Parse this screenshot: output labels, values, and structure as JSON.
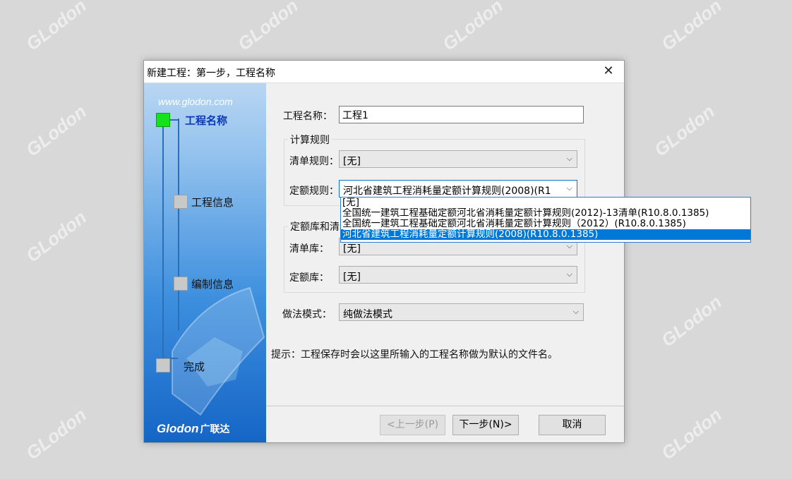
{
  "watermark": {
    "brand": "GLodon",
    "cn": "广联达"
  },
  "dialog": {
    "title": "新建工程：第一步，工程名称",
    "close_glyph": "✕"
  },
  "sidebar": {
    "site": "www.glodon.com",
    "steps": [
      {
        "label": "工程名称",
        "active": true
      },
      {
        "label": "工程信息",
        "active": false
      },
      {
        "label": "编制信息",
        "active": false
      },
      {
        "label": "完成",
        "active": false
      }
    ],
    "brand": "Glodon",
    "brand_cn": "广联达"
  },
  "form": {
    "project_name_label": "工程名称：",
    "project_name_value": "工程1",
    "calc_rules_group": "计算规则",
    "list_rule_label": "清单规则：",
    "list_rule_value": "[无]",
    "quota_rule_label": "定额规则：",
    "quota_rule_value": "河北省建筑工程消耗量定额计算规则(2008)(R1",
    "library_group": "定额库和清单库",
    "list_lib_label": "清单库：",
    "list_lib_value": "[无]",
    "quota_lib_label": "定额库：",
    "quota_lib_value": "[无]",
    "method_label": "做法模式：",
    "method_value": "纯做法模式",
    "hint": "提示：工程保存时会以这里所输入的工程名称做为默认的文件名。"
  },
  "dropdown": {
    "options": [
      "[无]",
      "全国统一建筑工程基础定额河北省消耗量定额计算规则(2012)-13清单(R10.8.0.1385)",
      "全国统一建筑工程基础定额河北省消耗量定额计算规则（2012）(R10.8.0.1385)",
      "河北省建筑工程消耗量定额计算规则(2008)(R10.8.0.1385)"
    ],
    "selected_index": 3
  },
  "buttons": {
    "prev": "<上一步(P)",
    "next": "下一步(N)>",
    "cancel": "取消"
  },
  "colors": {
    "active_step": "#15e21a",
    "selection": "#0078d7",
    "step_label_active": "#0a39b5"
  }
}
